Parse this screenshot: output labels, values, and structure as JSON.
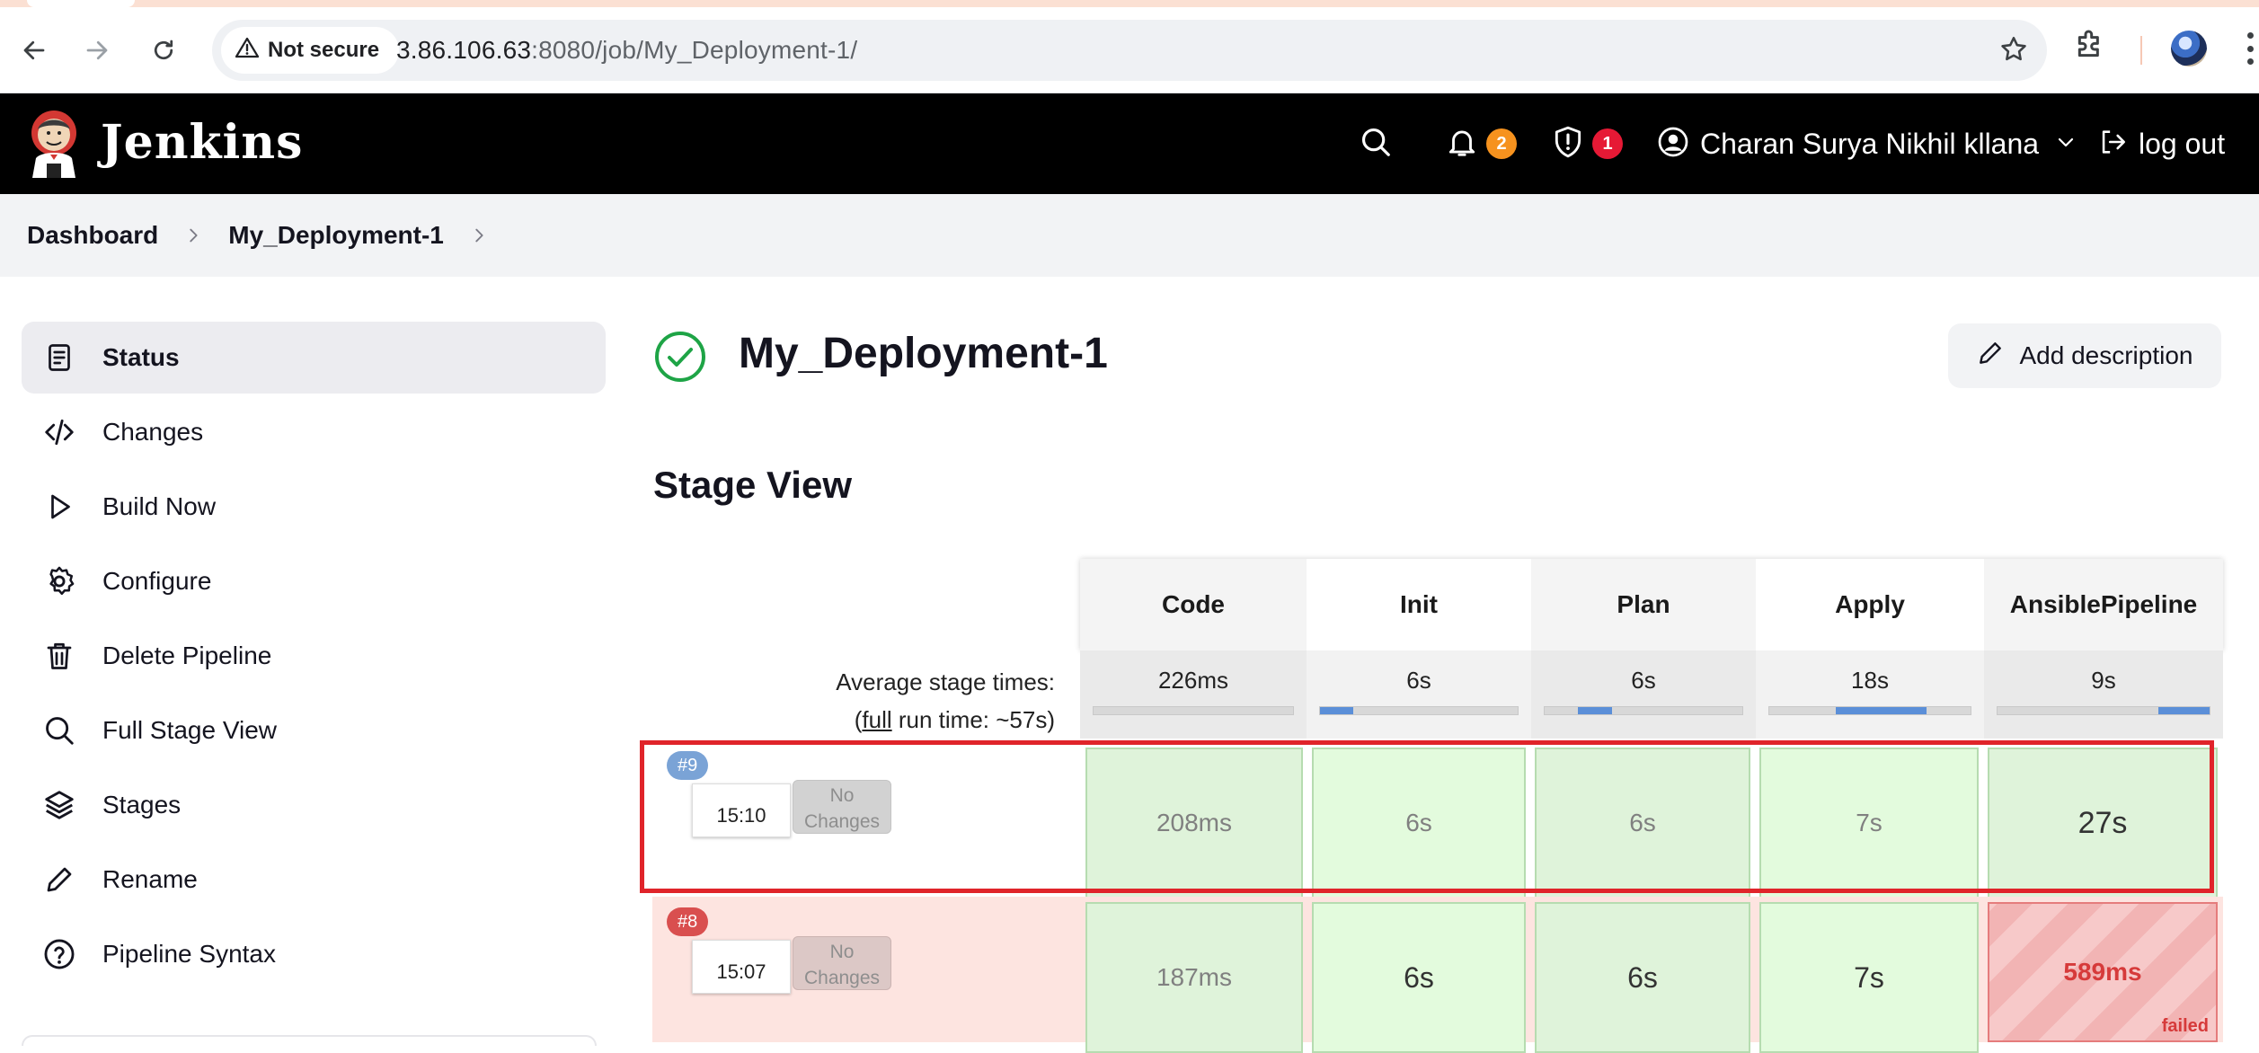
{
  "browser": {
    "security_label": "Not secure",
    "url_host": "3.86.106.63",
    "url_rest": ":8080/job/My_Deployment-1/"
  },
  "header": {
    "app_title": "Jenkins",
    "notifications_count": "2",
    "security_count": "1",
    "user_name": "Charan Surya Nikhil kllana",
    "logout_label": "log out"
  },
  "breadcrumb": [
    "Dashboard",
    "My_Deployment-1"
  ],
  "sidebar": {
    "items": [
      {
        "label": "Status",
        "icon": "document-icon"
      },
      {
        "label": "Changes",
        "icon": "code-icon"
      },
      {
        "label": "Build Now",
        "icon": "play-icon"
      },
      {
        "label": "Configure",
        "icon": "gear-icon"
      },
      {
        "label": "Delete Pipeline",
        "icon": "trash-icon"
      },
      {
        "label": "Full Stage View",
        "icon": "search-icon"
      },
      {
        "label": "Stages",
        "icon": "layers-icon"
      },
      {
        "label": "Rename",
        "icon": "pencil-icon"
      },
      {
        "label": "Pipeline Syntax",
        "icon": "help-icon"
      }
    ]
  },
  "main": {
    "job_title": "My_Deployment-1",
    "add_description_label": "Add description",
    "stage_view_title": "Stage View"
  },
  "stage_view": {
    "stages": [
      "Code",
      "Init",
      "Plan",
      "Apply",
      "AnsiblePipeline"
    ],
    "average_label": "Average stage times:",
    "full_prefix": "(",
    "full_link": "full",
    "full_suffix": " run time: ~57s)",
    "averages": [
      "226ms",
      "6s",
      "6s",
      "18s",
      "9s"
    ],
    "average_bar_fill": [
      0.0,
      0.17,
      0.17,
      0.45,
      0.24
    ],
    "runs": [
      {
        "number": "#9",
        "time": "15:10",
        "changes": "No Changes",
        "status": "success",
        "durations": [
          "208ms",
          "6s",
          "6s",
          "7s",
          "27s"
        ]
      },
      {
        "number": "#8",
        "time": "15:07",
        "changes": "No Changes",
        "status": "failed",
        "durations": [
          "187ms",
          "6s",
          "6s",
          "7s",
          "589ms"
        ],
        "failed_label": "failed"
      }
    ]
  },
  "colors": {
    "success_green": "#1ea446",
    "failed_red": "#d63a3a",
    "highlight": "#e0242a",
    "notification_badge": "#f6921e",
    "security_badge": "#e61935"
  }
}
